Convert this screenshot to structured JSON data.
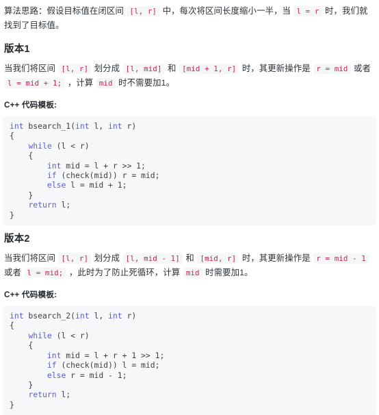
{
  "document": {
    "intro": {
      "segments": [
        {
          "type": "text",
          "value": "算法思路：假设目标值在闭区间 "
        },
        {
          "type": "code",
          "value": "[l, r]"
        },
        {
          "type": "text",
          "value": " 中，每次将区间长度缩小一半，当 "
        },
        {
          "type": "code",
          "value": "l = r"
        },
        {
          "type": "text",
          "value": " 时，我们就找到了目标值。"
        }
      ],
      "plain": "算法思路：假设目标值在闭区间 [l, r] 中，每次将区间长度缩小一半，当 l = r 时，我们就找到了目标值。"
    },
    "sections": [
      {
        "id": "version-1",
        "heading": "版本1",
        "paragraph": {
          "segments": [
            {
              "type": "text",
              "value": "当我们将区间 "
            },
            {
              "type": "code",
              "value": "[l, r]"
            },
            {
              "type": "text",
              "value": " 划分成 "
            },
            {
              "type": "code",
              "value": "[l, mid]"
            },
            {
              "type": "text",
              "value": " 和 "
            },
            {
              "type": "code",
              "value": "[mid + 1, r]"
            },
            {
              "type": "text",
              "value": " 时，其更新操作是 "
            },
            {
              "type": "code",
              "value": "r = mid"
            },
            {
              "type": "text",
              "value": " 或者 "
            },
            {
              "type": "code",
              "value": "l = mid + 1;"
            },
            {
              "type": "text",
              "value": " ，计算 "
            },
            {
              "type": "code",
              "value": "mid"
            },
            {
              "type": "text",
              "value": " 时不需要加1。"
            }
          ],
          "plain": "当我们将区间 [l, r] 划分成 [l, mid] 和 [mid + 1, r] 时，其更新操作是 r = mid 或者 l = mid + 1; ，计算 mid 时不需要加1。"
        },
        "code_label": "C++ 代码模板:",
        "code_language": "cpp",
        "code_lines": [
          [
            {
              "t": "kw",
              "v": "int"
            },
            {
              "t": "plain",
              "v": " bsearch_1("
            },
            {
              "t": "kw",
              "v": "int"
            },
            {
              "t": "plain",
              "v": " l, "
            },
            {
              "t": "kw",
              "v": "int"
            },
            {
              "t": "plain",
              "v": " r)"
            }
          ],
          [
            {
              "t": "plain",
              "v": "{"
            }
          ],
          [
            {
              "t": "plain",
              "v": "    "
            },
            {
              "t": "kw",
              "v": "while"
            },
            {
              "t": "plain",
              "v": " (l < r)"
            }
          ],
          [
            {
              "t": "plain",
              "v": "    {"
            }
          ],
          [
            {
              "t": "plain",
              "v": "        "
            },
            {
              "t": "kw",
              "v": "int"
            },
            {
              "t": "plain",
              "v": " mid = l + r >> 1;"
            }
          ],
          [
            {
              "t": "plain",
              "v": "        "
            },
            {
              "t": "kw",
              "v": "if"
            },
            {
              "t": "plain",
              "v": " (check(mid)) r = mid;"
            }
          ],
          [
            {
              "t": "plain",
              "v": "        "
            },
            {
              "t": "kw",
              "v": "else"
            },
            {
              "t": "plain",
              "v": " l = mid + 1;"
            }
          ],
          [
            {
              "t": "plain",
              "v": "    }"
            }
          ],
          [
            {
              "t": "plain",
              "v": "    "
            },
            {
              "t": "kw",
              "v": "return"
            },
            {
              "t": "plain",
              "v": " l;"
            }
          ],
          [
            {
              "t": "plain",
              "v": "}"
            }
          ]
        ],
        "code_plain": "int bsearch_1(int l, int r)\n{\n    while (l < r)\n    {\n        int mid = l + r >> 1;\n        if (check(mid)) r = mid;\n        else l = mid + 1;\n    }\n    return l;\n}"
      },
      {
        "id": "version-2",
        "heading": "版本2",
        "paragraph": {
          "segments": [
            {
              "type": "text",
              "value": "当我们将区间 "
            },
            {
              "type": "code",
              "value": "[l, r]"
            },
            {
              "type": "text",
              "value": " 划分成 "
            },
            {
              "type": "code",
              "value": "[l, mid - 1]"
            },
            {
              "type": "text",
              "value": " 和 "
            },
            {
              "type": "code",
              "value": "[mid, r]"
            },
            {
              "type": "text",
              "value": " 时，其更新操作是 "
            },
            {
              "type": "code",
              "value": "r = mid - 1"
            },
            {
              "type": "text",
              "value": " 或者 "
            },
            {
              "type": "code",
              "value": "l = mid;"
            },
            {
              "type": "text",
              "value": " ，此时为了防止死循环，计算 "
            },
            {
              "type": "code",
              "value": "mid"
            },
            {
              "type": "text",
              "value": " 时需要加1。"
            }
          ],
          "plain": "当我们将区间 [l, r] 划分成 [l, mid - 1] 和 [mid, r] 时，其更新操作是 r = mid - 1 或者 l = mid; ，此时为了防止死循环，计算 mid 时需要加1。"
        },
        "code_label": "C++ 代码模板:",
        "code_language": "cpp",
        "code_lines": [
          [
            {
              "t": "kw",
              "v": "int"
            },
            {
              "t": "plain",
              "v": " bsearch_2("
            },
            {
              "t": "kw",
              "v": "int"
            },
            {
              "t": "plain",
              "v": " l, "
            },
            {
              "t": "kw",
              "v": "int"
            },
            {
              "t": "plain",
              "v": " r)"
            }
          ],
          [
            {
              "t": "plain",
              "v": "{"
            }
          ],
          [
            {
              "t": "plain",
              "v": "    "
            },
            {
              "t": "kw",
              "v": "while"
            },
            {
              "t": "plain",
              "v": " (l < r)"
            }
          ],
          [
            {
              "t": "plain",
              "v": "    {"
            }
          ],
          [
            {
              "t": "plain",
              "v": "        "
            },
            {
              "t": "kw",
              "v": "int"
            },
            {
              "t": "plain",
              "v": " mid = l + r + 1 >> 1;"
            }
          ],
          [
            {
              "t": "plain",
              "v": "        "
            },
            {
              "t": "kw",
              "v": "if"
            },
            {
              "t": "plain",
              "v": " (check(mid)) l = mid;"
            }
          ],
          [
            {
              "t": "plain",
              "v": "        "
            },
            {
              "t": "kw",
              "v": "else"
            },
            {
              "t": "plain",
              "v": " r = mid - 1;"
            }
          ],
          [
            {
              "t": "plain",
              "v": "    }"
            }
          ],
          [
            {
              "t": "plain",
              "v": "    "
            },
            {
              "t": "kw",
              "v": "return"
            },
            {
              "t": "plain",
              "v": " l;"
            }
          ],
          [
            {
              "t": "plain",
              "v": "}"
            }
          ]
        ],
        "code_plain": "int bsearch_2(int l, int r)\n{\n    while (l < r)\n    {\n        int mid = l + r + 1 >> 1;\n        if (check(mid)) l = mid;\n        else r = mid - 1;\n    }\n    return l;\n}"
      }
    ],
    "theme": {
      "page_background": "#ffffff",
      "body_text": "#2d3338",
      "heading_text": "#24292e",
      "inline_code_text": "#c7254e",
      "inline_code_background": "#f5f6f7",
      "code_block_background": "#f6f7f9",
      "code_block_text": "#3b3f45",
      "code_keyword": "#5b5bd6"
    }
  }
}
